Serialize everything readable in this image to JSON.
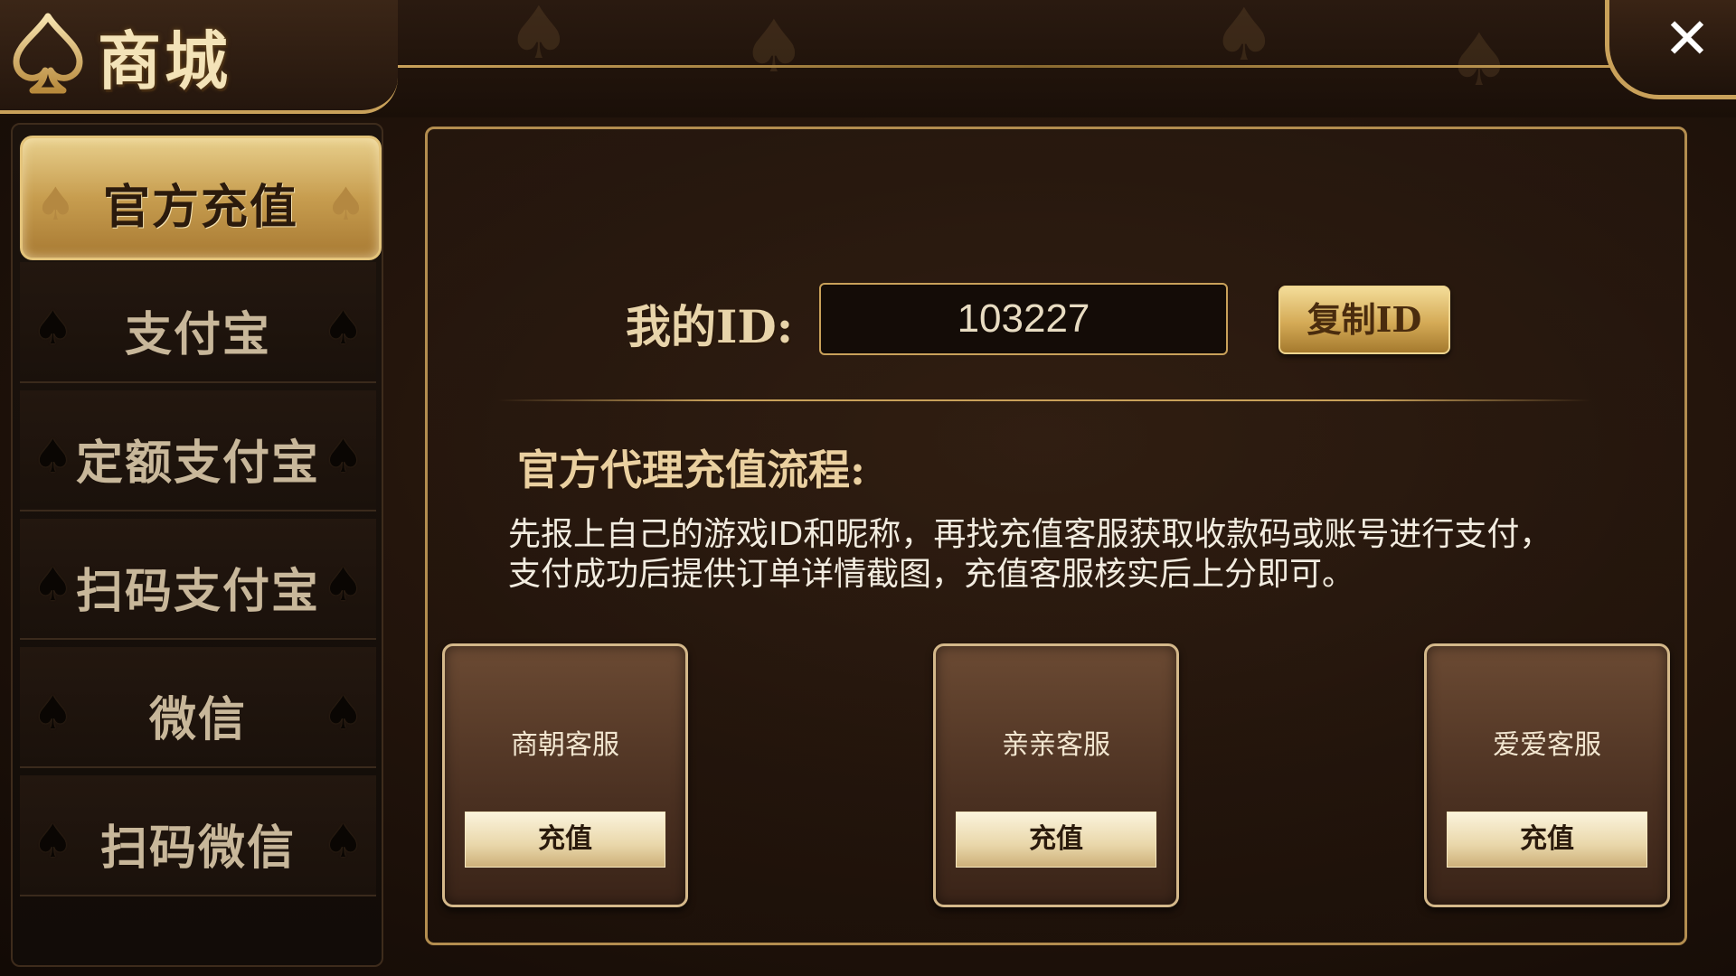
{
  "header": {
    "title": "商城",
    "close_label": "✕"
  },
  "sidebar": {
    "items": [
      {
        "label": "官方充值",
        "active": true
      },
      {
        "label": "支付宝"
      },
      {
        "label": "定额支付宝"
      },
      {
        "label": "扫码支付宝"
      },
      {
        "label": "微信"
      },
      {
        "label": "扫码微信"
      }
    ]
  },
  "main": {
    "id_label": "我的ID:",
    "id_value": "103227",
    "copy_button_label": "复制ID",
    "process_title": "官方代理充值流程:",
    "process_lines": [
      "先报上自己的游戏ID和昵称，再找充值客服获取收款码或账号进行支付，",
      "支付成功后提供订单详情截图，充值客服核实后上分即可。"
    ],
    "agents": [
      {
        "name": "商朝客服",
        "button_label": "充值"
      },
      {
        "name": "亲亲客服",
        "button_label": "充值"
      },
      {
        "name": "爱爱客服",
        "button_label": "充值"
      }
    ]
  },
  "colors": {
    "gold": "#c9a15a",
    "background": "#24150c",
    "active_tab": "#d4aa56"
  },
  "icons": {
    "header": "spade-icon",
    "nav_decoration": "spade-icon",
    "close": "close-icon"
  }
}
